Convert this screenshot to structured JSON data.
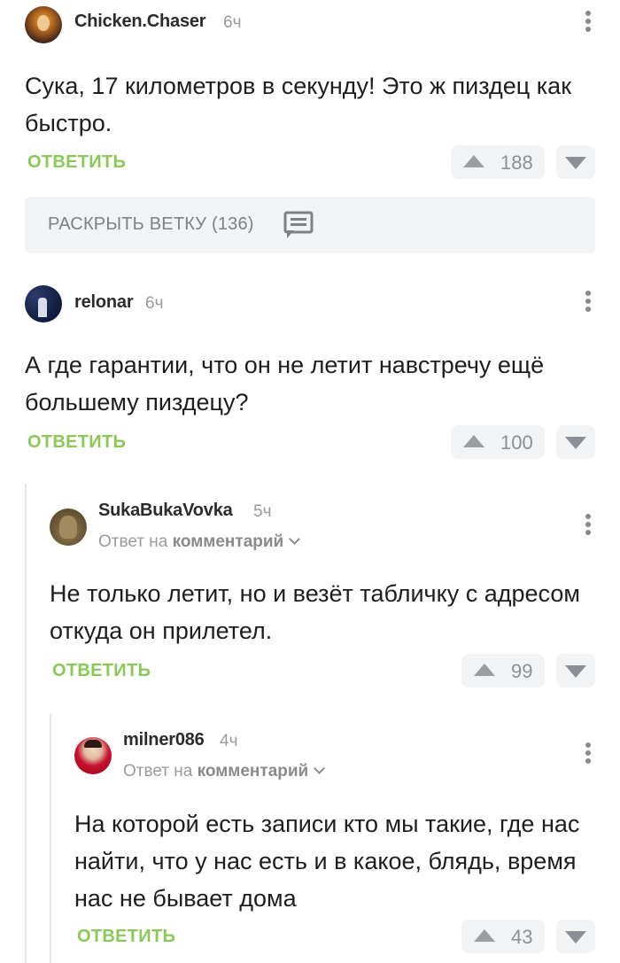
{
  "comments": [
    {
      "user": "Chicken.Chaser",
      "time": "6ч",
      "text": "Сука, 17 километров в секунду! Это ж пиздец как быстро.",
      "reply_label": "ОТВЕТИТЬ",
      "votes": "188"
    },
    {
      "user": "relonar",
      "time": "6ч",
      "text": "А где гарантии, что он не летит навстречу ещё большему пиздецу?",
      "reply_label": "ОТВЕТИТЬ",
      "votes": "100"
    },
    {
      "user": "SukaBukaVovka",
      "time": "5ч",
      "reply_to_prefix": "Ответ на",
      "reply_to_link": "комментарий",
      "text": "Не только летит, но и везёт табличку с адресом откуда он прилетел.",
      "reply_label": "ОТВЕТИТЬ",
      "votes": "99"
    },
    {
      "user": "milner086",
      "time": "4ч",
      "reply_to_prefix": "Ответ на",
      "reply_to_link": "комментарий",
      "text": "На которой есть записи кто мы такие, где нас найти, что у нас есть и в какое, блядь, время нас не бывает дома",
      "reply_label": "ОТВЕТИТЬ",
      "votes": "43"
    }
  ],
  "branch": {
    "label": "РАСКРЫТЬ ВЕТКУ (136)"
  },
  "colors": {
    "accent_green": "#8ac858",
    "vote_bg": "#f2f3f4",
    "muted_text": "#9a9a9a"
  },
  "icons": {
    "more": "more-vertical-icon",
    "upvote": "upvote-arrow-icon",
    "downvote": "downvote-arrow-icon",
    "branch": "comments-icon",
    "chevron": "chevron-down-icon"
  }
}
